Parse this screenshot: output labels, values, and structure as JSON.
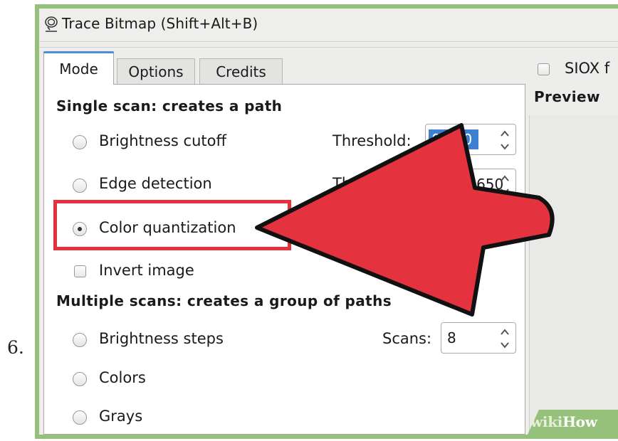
{
  "step_number": "6.",
  "window": {
    "title": "Trace Bitmap (Shift+Alt+B)",
    "title_icon": "trace-bitmap-icon"
  },
  "tabs": [
    {
      "label": "Mode",
      "active": true
    },
    {
      "label": "Options",
      "active": false
    },
    {
      "label": "Credits",
      "active": false
    }
  ],
  "single_scan": {
    "heading": "Single scan: creates a path",
    "options": [
      {
        "label": "Brightness cutoff",
        "selected": false
      },
      {
        "label": "Edge detection",
        "selected": false
      },
      {
        "label": "Color quantization",
        "selected": true
      }
    ],
    "brightness_threshold": {
      "label": "Threshold:",
      "value": "0.450"
    },
    "edge_threshold": {
      "label": "Threshold:",
      "value": "0.650"
    },
    "invert": {
      "label": "Invert image",
      "checked": false
    }
  },
  "multiple_scans": {
    "heading": "Multiple scans: creates a group of paths",
    "options": [
      {
        "label": "Brightness steps",
        "selected": false
      },
      {
        "label": "Colors",
        "selected": false
      },
      {
        "label": "Grays",
        "selected": false
      }
    ],
    "scans": {
      "label": "Scans:",
      "value": "8"
    }
  },
  "side": {
    "siox_label": "SIOX f",
    "siox_checked": false,
    "preview_label": "Preview"
  },
  "annotation": {
    "highlight_color": "#e4323f",
    "arrow_color": "#e4323f"
  },
  "watermark": {
    "part1": "wiki",
    "part2": "How"
  }
}
